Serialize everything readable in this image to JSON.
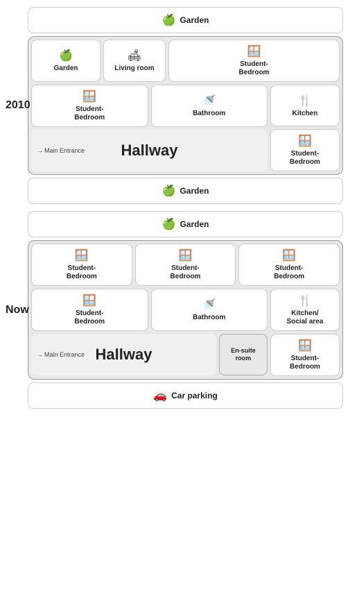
{
  "plan2010": {
    "label": "2010",
    "garden_top": {
      "label": "Garden",
      "icon": "🍏"
    },
    "garden_bottom": {
      "label": "Garden",
      "icon": "🍏"
    },
    "rooms": {
      "garden_left": {
        "label": "Garden",
        "icon": "🍏"
      },
      "living_room": {
        "label": "Living room",
        "icon": "🛋"
      },
      "student_bedroom_tr": {
        "label": "Student-\nBedroom",
        "icon": "🛏"
      },
      "student_bedroom_left": {
        "label": "Student-\nBedroom",
        "icon": "🛏"
      },
      "bathroom": {
        "label": "Bathroom",
        "icon": "🚿"
      },
      "kitchen": {
        "label": "Kitchen",
        "icon": "🍴"
      },
      "student_bedroom_br": {
        "label": "Student-\nBedroom",
        "icon": "🛏"
      },
      "hallway": {
        "label": "Hallway"
      },
      "entrance": {
        "label": "Main Entrance"
      }
    }
  },
  "planNow": {
    "label": "Now",
    "garden_top": {
      "label": "Garden",
      "icon": "🍏"
    },
    "garden_bottom": {
      "label": "Car parking",
      "icon": "🚗"
    },
    "rooms": {
      "student_bedroom_1": {
        "label": "Student-\nBedroom",
        "icon": "🛏"
      },
      "student_bedroom_2": {
        "label": "Student-\nBedroom",
        "icon": "🛏"
      },
      "student_bedroom_3": {
        "label": "Student-\nBedroom",
        "icon": "🛏"
      },
      "student_bedroom_4": {
        "label": "Student-\nBedroom",
        "icon": "🛏"
      },
      "bathroom": {
        "label": "Bathroom",
        "icon": "🚿"
      },
      "kitchen_social": {
        "label": "Kitchen/\nSocial area",
        "icon": "🍴"
      },
      "student_bedroom_br": {
        "label": "Student-\nBedroom",
        "icon": "🛏"
      },
      "ensuite_room": {
        "label": "En-suite\nroom"
      },
      "hallway": {
        "label": "Hallway"
      },
      "entrance": {
        "label": "Main Entrance"
      }
    }
  }
}
